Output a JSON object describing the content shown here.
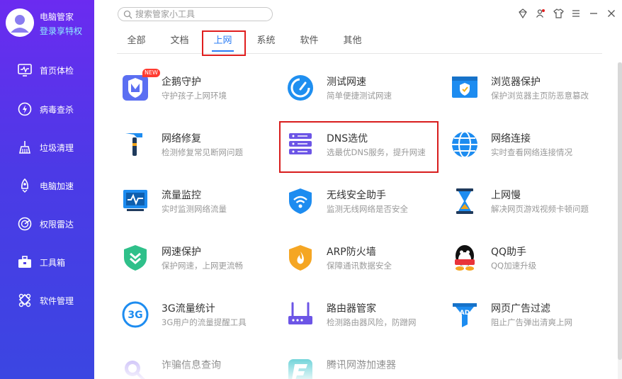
{
  "profile": {
    "name": "电脑管家",
    "link": "登录享特权"
  },
  "nav": [
    {
      "label": "首页体检",
      "icon": "monitor-icon"
    },
    {
      "label": "病毒查杀",
      "icon": "lightning-shield-icon"
    },
    {
      "label": "垃圾清理",
      "icon": "broom-icon"
    },
    {
      "label": "电脑加速",
      "icon": "rocket-icon"
    },
    {
      "label": "权限雷达",
      "icon": "radar-icon"
    },
    {
      "label": "工具箱",
      "icon": "toolbox-icon"
    },
    {
      "label": "软件管理",
      "icon": "apps-icon"
    }
  ],
  "search": {
    "placeholder": "搜索管家小工具"
  },
  "window_controls": [
    "skin-diamond-icon",
    "user-settings-icon",
    "shirt-icon",
    "menu-icon",
    "minimize-icon",
    "close-icon"
  ],
  "tabs": [
    {
      "label": "全部"
    },
    {
      "label": "文档"
    },
    {
      "label": "上网",
      "active": true
    },
    {
      "label": "系统"
    },
    {
      "label": "软件"
    },
    {
      "label": "其他"
    }
  ],
  "tools": [
    {
      "name": "企鹅守护",
      "desc": "守护孩子上网环境",
      "icon": "penguin-guard-icon",
      "badge": "NEW"
    },
    {
      "name": "测试网速",
      "desc": "简单便捷测试网速",
      "icon": "speedometer-icon"
    },
    {
      "name": "浏览器保护",
      "desc": "保护浏览器主页防恶意篡改",
      "icon": "browser-shield-icon"
    },
    {
      "name": "网络修复",
      "desc": "检测修复常见断网问题",
      "icon": "hammer-icon"
    },
    {
      "name": "DNS选优",
      "desc": "选最优DNS服务，提升网速",
      "icon": "dns-server-icon"
    },
    {
      "name": "网络连接",
      "desc": "实时查看网络连接情况",
      "icon": "globe-icon"
    },
    {
      "name": "流量监控",
      "desc": "实时监测网络流量",
      "icon": "traffic-monitor-icon"
    },
    {
      "name": "无线安全助手",
      "desc": "监测无线网络是否安全",
      "icon": "wifi-shield-icon"
    },
    {
      "name": "上网慢",
      "desc": "解决网页游戏视频卡顿问题",
      "icon": "hourglass-icon"
    },
    {
      "name": "网速保护",
      "desc": "保护网速，上网更流畅",
      "icon": "speed-shield-icon"
    },
    {
      "name": "ARP防火墙",
      "desc": "保障通讯数据安全",
      "icon": "firewall-icon"
    },
    {
      "name": "QQ助手",
      "desc": "QQ加速升级",
      "icon": "qq-penguin-icon"
    },
    {
      "name": "3G流量统计",
      "desc": "3G用户的流量提醒工具",
      "icon": "3g-icon"
    },
    {
      "name": "路由器管家",
      "desc": "检测路由器风险，防蹭网",
      "icon": "router-icon"
    },
    {
      "name": "网页广告过滤",
      "desc": "阻止广告弹出清爽上网",
      "icon": "ad-filter-icon"
    },
    {
      "name": "诈骗信息查询",
      "desc": "",
      "icon": "fraud-search-icon"
    },
    {
      "name": "腾讯网游加速器",
      "desc": "",
      "icon": "game-accelerator-icon"
    }
  ],
  "colors": {
    "sidebar_top": "#6b2bf0",
    "sidebar_bottom": "#3b46e2",
    "accent": "#2b7cf5",
    "highlight": "#e01e1e"
  }
}
